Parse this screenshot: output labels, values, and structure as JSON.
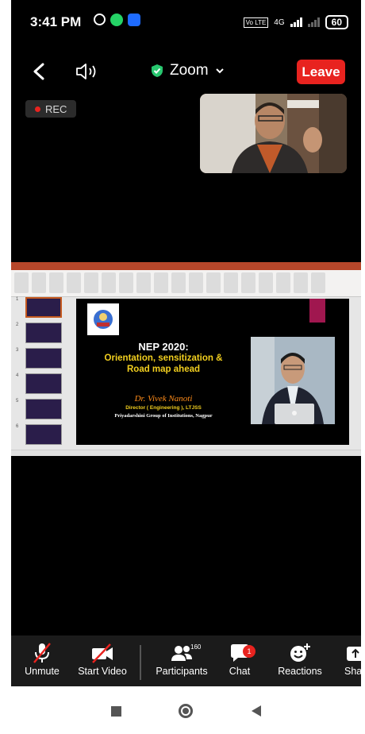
{
  "status_bar": {
    "time": "3:41 PM",
    "network_label": "4G",
    "volte_label": "Vo LTE",
    "battery": "60"
  },
  "meeting": {
    "title": "Zoom",
    "leave_label": "Leave",
    "rec_label": "REC",
    "leave_color": "#e8231f"
  },
  "slide": {
    "title_line1": "NEP 2020:",
    "title_line2": "Orientation, sensitization &",
    "title_line3": "Road map ahead",
    "presenter_name": "Dr. Vivek Nanoti",
    "presenter_role": "Director ( Engineering ), LTJSS",
    "presenter_org": "Priyadarshini Group of Institutions, Nagpur"
  },
  "slide_thumbnails": [
    "1",
    "2",
    "3",
    "4",
    "5",
    "6"
  ],
  "toolbar": {
    "unmute_label": "Unmute",
    "start_video_label": "Start Video",
    "participants_label": "Participants",
    "participants_count": "160",
    "chat_label": "Chat",
    "chat_badge": "1",
    "reactions_label": "Reactions",
    "share_label": "Sha"
  }
}
